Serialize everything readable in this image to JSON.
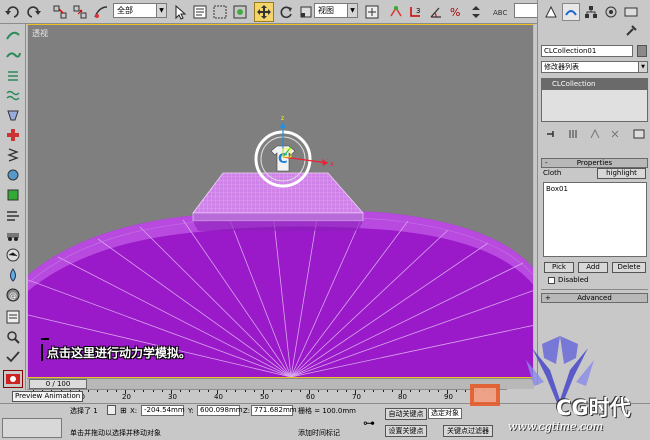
{
  "toolbar": {
    "selection_filter": "全部",
    "ref_coord": "视图"
  },
  "viewport": {
    "label": "透视",
    "caption": "点击这里进行动力学模拟。"
  },
  "panel": {
    "object_name": "CLCollection01",
    "modifier_list": "修改器列表",
    "stack_item": "CLCollection",
    "properties": {
      "header": "Properties",
      "cloth_label": "Cloth",
      "highlight_button": "highlight",
      "cloth_list": [
        "Box01"
      ],
      "pick_button": "Pick",
      "add_button": "Add",
      "delete_button": "Delete",
      "disabled_label": "Disabled"
    },
    "advanced_header": "Advanced"
  },
  "timeline": {
    "frame_display": "0 / 100",
    "ticks": [
      "0",
      "10",
      "20",
      "30",
      "40",
      "50",
      "60",
      "70",
      "80",
      "90"
    ]
  },
  "status": {
    "preview_label": "Preview Animation",
    "selected": "选择了 1",
    "x_label": "X:",
    "x_value": "-204.54mm",
    "y_label": "Y:",
    "y_value": "600.098mm",
    "z_label": "Z:",
    "z_value": "771.682mm",
    "grid": "栅格 = 100.0mm",
    "prompt": "单击并拖动以选择并移动对象",
    "add_time_tag": "添加时间标记",
    "auto_key": "自动关键点",
    "selected_obj": "选定对象",
    "set_key": "设置关键点",
    "key_filter": "关键点过滤器"
  },
  "watermark": {
    "text": "CG时代",
    "url": "www.cgtime.com"
  },
  "colors": {
    "ground_top": "#b84ae0",
    "ground_fill": "#9a19c9",
    "cloth": "#cf82e8",
    "viewport_bg": "#7f7f7f",
    "active_tool": "#f3d56a"
  }
}
